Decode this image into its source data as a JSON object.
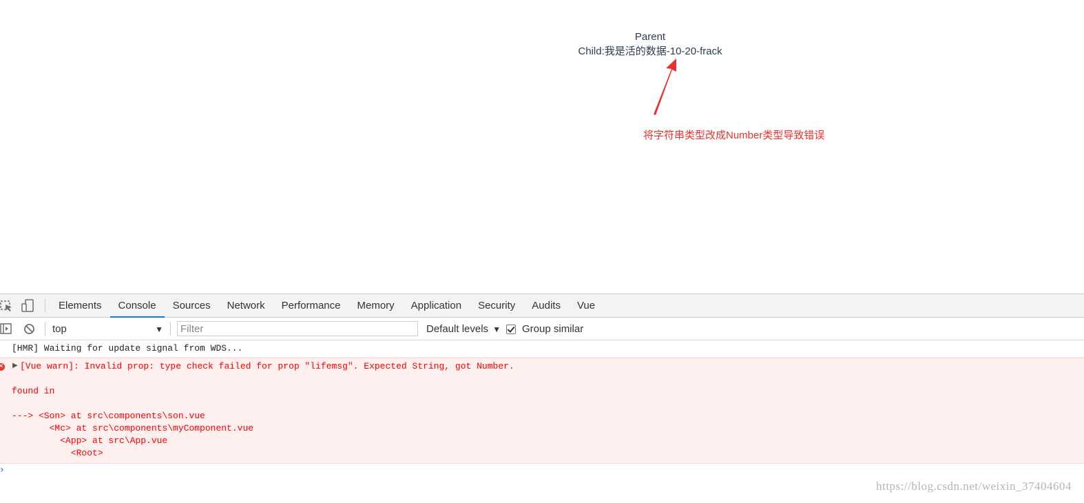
{
  "page": {
    "parent_label": "Parent",
    "child_label": "Child:我是活的数据-10-20-frack"
  },
  "annotation": {
    "text": "将字符串类型改成Number类型导致错误",
    "color": "#e8322e"
  },
  "devtools": {
    "icons": [
      "inspect-element-icon",
      "device-toolbar-icon"
    ],
    "tabs": [
      {
        "label": "Elements"
      },
      {
        "label": "Console",
        "active": true
      },
      {
        "label": "Sources"
      },
      {
        "label": "Network"
      },
      {
        "label": "Performance"
      },
      {
        "label": "Memory"
      },
      {
        "label": "Application"
      },
      {
        "label": "Security"
      },
      {
        "label": "Audits"
      },
      {
        "label": "Vue"
      }
    ],
    "accent_color": "#1a73e8",
    "console_toolbar": {
      "context": "top",
      "filter_placeholder": "Filter",
      "levels": "Default levels",
      "group_similar_label": "Group similar",
      "group_similar_checked": true
    },
    "messages": {
      "info": "[HMR] Waiting for update signal from WDS...",
      "error_lines": [
        "[Vue warn]: Invalid prop: type check failed for prop \"lifemsg\". Expected String, got Number.",
        "found in",
        "---> <Son> at src\\components\\son.vue",
        "       <Mc> at src\\components\\myComponent.vue",
        "         <App> at src\\App.vue",
        "           <Root>"
      ],
      "error_color": "#ff0000"
    },
    "prompt_symbol": "›"
  },
  "watermark": "https://blog.csdn.net/weixin_37404604"
}
